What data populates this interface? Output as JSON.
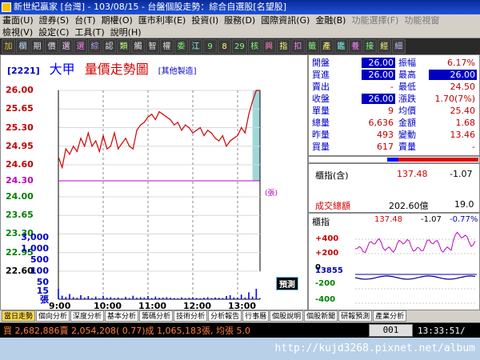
{
  "window": {
    "title": "新世紀贏家 [台灣] - 103/08/15 - 台盤個股走勢：綜合自選股[名望股]",
    "right_items": [
      "功能選擇(F)",
      "功能視窗"
    ]
  },
  "menu": {
    "line1": [
      "畫面(U)",
      "證券(S)",
      "台(T)",
      "期權(O)",
      "匯市利率(E)",
      "投資(I)",
      "服務(D)",
      "國際資訊(G)",
      "金融(B)",
      "功能選擇(F)",
      "功能視窗"
    ],
    "line2": [
      "檢視(V)",
      "設定(C)",
      "工具(T)",
      "說明(H)"
    ]
  },
  "toolbar": {
    "buttons": [
      "加",
      "欄",
      "期",
      "價",
      "選",
      "選",
      "綜",
      "認",
      "類",
      "觸",
      "智",
      "權",
      "委",
      "江",
      "9",
      "8",
      "29",
      "核",
      "興",
      "指",
      "扣",
      "籤",
      "產",
      "鑑",
      "養",
      "接",
      "經",
      "細"
    ]
  },
  "chart_header": {
    "code": "[2221]",
    "name": "大甲",
    "title": "量價走勢圖",
    "note": "[其他製造]"
  },
  "chart_data": {
    "type": "line",
    "title": "量價走勢圖",
    "price_ticks": [
      "26.00",
      "25.65",
      "25.30",
      "24.95",
      "24.60",
      "24.30",
      "24.00",
      "23.65",
      "23.30",
      "22.95",
      "22.60"
    ],
    "volume_ticks": [
      "3,000",
      "1,000",
      "500",
      "100",
      "50",
      "15",
      "張"
    ],
    "time_ticks": [
      "9:00",
      "10:00",
      "11:00",
      "12:00",
      "13:00"
    ],
    "ylim": [
      22.6,
      26.0
    ],
    "reference_price": 24.3,
    "series": [
      {
        "name": "成交價",
        "x": [
          "9:00",
          "9:05",
          "9:10",
          "9:15",
          "9:20",
          "9:25",
          "9:30",
          "9:35",
          "9:40",
          "9:45",
          "9:50",
          "9:55",
          "10:00",
          "10:05",
          "10:10",
          "10:15",
          "10:20",
          "10:25",
          "10:30",
          "10:35",
          "10:40",
          "10:45",
          "10:50",
          "10:55",
          "11:00",
          "11:05",
          "11:10",
          "11:15",
          "11:20",
          "11:25",
          "11:30",
          "11:35",
          "11:40",
          "11:45",
          "11:50",
          "11:55",
          "12:00",
          "12:05",
          "12:10",
          "12:15",
          "12:20",
          "12:25",
          "12:30",
          "12:35",
          "12:40",
          "12:45",
          "12:50",
          "12:55",
          "13:00",
          "13:05",
          "13:10",
          "13:15",
          "13:20",
          "13:25",
          "13:30"
        ],
        "values": [
          24.75,
          24.55,
          24.9,
          24.8,
          24.95,
          24.85,
          25.1,
          24.95,
          25.2,
          24.95,
          25.05,
          24.85,
          25.15,
          24.9,
          24.95,
          25.2,
          24.9,
          25.0,
          25.1,
          24.95,
          24.9,
          25.25,
          25.35,
          25.4,
          25.5,
          25.55,
          25.45,
          25.6,
          25.55,
          25.5,
          25.45,
          25.35,
          25.4,
          25.25,
          25.35,
          25.3,
          25.2,
          25.25,
          25.3,
          25.15,
          25.25,
          25.2,
          25.1,
          25.05,
          25.15,
          24.95,
          25.05,
          25.1,
          25.15,
          25.3,
          25.2,
          25.55,
          25.8,
          26.0,
          26.0
        ]
      },
      {
        "name": "均價",
        "x": [
          "9:00",
          "10:00",
          "11:00",
          "12:00",
          "13:00",
          "13:30"
        ],
        "values": [
          24.3,
          24.3,
          24.3,
          24.3,
          24.3,
          24.3
        ]
      }
    ],
    "volume": [
      180,
      60,
      40,
      90,
      35,
      25,
      70,
      30,
      55,
      20,
      45,
      15,
      60,
      25,
      35,
      20,
      30,
      15,
      40,
      20,
      60,
      25,
      35,
      30,
      55,
      20,
      45,
      25,
      30,
      35,
      25,
      20,
      15,
      30,
      20,
      25,
      30,
      20,
      15,
      25,
      35,
      20,
      30,
      25,
      20,
      55,
      70,
      30,
      25,
      80,
      30,
      120,
      45,
      180,
      20
    ]
  },
  "quote": {
    "rows": [
      {
        "l1": "開盤",
        "v1": "26.00",
        "l2": "振幅",
        "v2": "6.17%",
        "hl1": true,
        "hl2": false
      },
      {
        "l1": "買進",
        "v1": "26.00",
        "l2": "最高",
        "v2": "26.00",
        "hl1": true,
        "hl2": true
      },
      {
        "l1": "賣出",
        "v1": "-",
        "l2": "最低",
        "v2": "24.50",
        "hl1": false,
        "hl2": false
      },
      {
        "l1": "收盤",
        "v1": "26.00",
        "l2": "漲跌",
        "v2": "1.70(7%)",
        "hl1": true,
        "hl2": false
      },
      {
        "l1": "單量",
        "v1": "9",
        "l2": "均價",
        "v2": "25.40",
        "hl1": false,
        "hl2": false
      },
      {
        "l1": "總量",
        "v1": "6,636",
        "l2": "金額",
        "v2": "1.68",
        "hl1": false,
        "hl2": false
      },
      {
        "l1": "昨量",
        "v1": "493",
        "l2": "變動",
        "v2": "13.46",
        "hl1": false,
        "hl2": false
      },
      {
        "l1": "買量",
        "v1": "617",
        "l2": "賣量",
        "v2": "-",
        "hl1": false,
        "hl2": false
      }
    ]
  },
  "index": {
    "label": "櫃指(含)",
    "value": "137.48",
    "change": "-1.07",
    "turnover_label": "成交總額",
    "turnover": "202.60億",
    "turnover_extra": "19.0"
  },
  "mini": {
    "label": "櫃指",
    "value": "137.48",
    "change": "-1.07",
    "pct": "-0.77%",
    "ticks": [
      "+400",
      "+200",
      "0",
      "13855",
      "-200",
      "-400"
    ]
  },
  "tabs": [
    "當日走勢",
    "個向分析",
    "深度分析",
    "基本分析",
    "籌碼分析",
    "技術分析",
    "分析報告",
    "行事曆",
    "個股說明",
    "個股新聞",
    "研報預測",
    "產業分析"
  ],
  "status": {
    "text": "買 2,682,886賣 2,054,208( 0.77)成 1,065,183張, 均張 5.0",
    "box": "001",
    "clock": "13:33:51/"
  },
  "watermark": "http://kujd3268.pixnet.net/album",
  "colors": {
    "up": "#d00000",
    "down": "#008000",
    "avg": "#c000c0",
    "volume": "#0000ff",
    "limit_fill": "#9fd8d8"
  },
  "labels": {
    "predict": "預測",
    "sheet": "(張)"
  }
}
